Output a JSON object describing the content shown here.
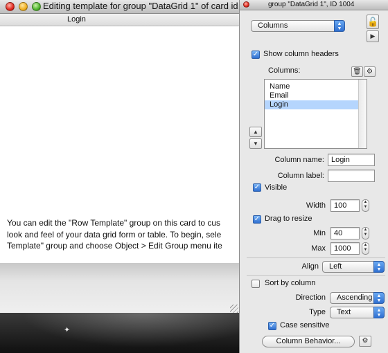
{
  "editor_window": {
    "title": "Editing template for group \"DataGrid 1\" of card id",
    "header_label": "Login",
    "instructions": [
      "You can edit the \"Row Template\" group on this card to cus",
      "look and feel of your data grid form or table. To begin, sele",
      "Template\" group and choose Object > Edit Group menu ite"
    ]
  },
  "inspector": {
    "title": "group \"DataGrid 1\", ID 1004",
    "section_selector": {
      "value": "Columns",
      "icon": "up-down-arrows-icon"
    },
    "lock_icon": "padlock-icon",
    "play_icon": "play-icon",
    "show_column_headers": {
      "label": "Show column headers",
      "checked": true
    },
    "columns_label": "Columns:",
    "columns_list": [
      {
        "name": "Name",
        "selected": false
      },
      {
        "name": "Email",
        "selected": false
      },
      {
        "name": "Login",
        "selected": true
      }
    ],
    "move_up_glyph": "▲",
    "move_down_glyph": "▼",
    "column_name": {
      "label": "Column name:",
      "value": "Login"
    },
    "column_label": {
      "label": "Column label:",
      "value": ""
    },
    "visible": {
      "label": "Visible",
      "checked": true
    },
    "width": {
      "label": "Width",
      "value": "100"
    },
    "drag_to_resize": {
      "label": "Drag to resize",
      "checked": true
    },
    "min": {
      "label": "Min",
      "value": "40"
    },
    "max": {
      "label": "Max",
      "value": "1000"
    },
    "align": {
      "label": "Align",
      "value": "Left"
    },
    "sort_by_column": {
      "label": "Sort by column",
      "checked": false
    },
    "direction": {
      "label": "Direction",
      "value": "Ascending"
    },
    "type": {
      "label": "Type",
      "value": "Text"
    },
    "case_sensitive": {
      "label": "Case sensitive",
      "checked": true
    },
    "column_behavior_button": "Column Behavior...",
    "gear_icon": "gear-icon",
    "trash_icon": "trash-icon",
    "colors": {
      "accent": "#2f6fd0",
      "selection": "#b5d5fd"
    }
  }
}
